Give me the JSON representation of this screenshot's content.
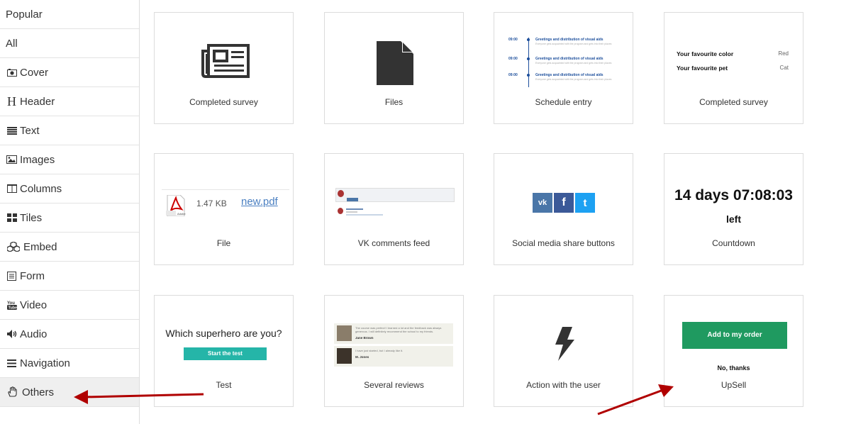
{
  "sidebar": {
    "items": [
      {
        "label": "Popular",
        "icon": ""
      },
      {
        "label": "All",
        "icon": ""
      },
      {
        "label": "Cover",
        "icon": "camera-icon"
      },
      {
        "label": "Header",
        "icon": "header-icon"
      },
      {
        "label": "Text",
        "icon": "text-lines-icon"
      },
      {
        "label": "Images",
        "icon": "image-icon"
      },
      {
        "label": "Columns",
        "icon": "columns-icon"
      },
      {
        "label": "Tiles",
        "icon": "tiles-icon"
      },
      {
        "label": "Embed",
        "icon": "cubes-icon"
      },
      {
        "label": "Form",
        "icon": "form-icon"
      },
      {
        "label": "Video",
        "icon": "youtube-icon"
      },
      {
        "label": "Audio",
        "icon": "speaker-icon"
      },
      {
        "label": "Navigation",
        "icon": "bars-icon"
      },
      {
        "label": "Others",
        "icon": "hand-icon"
      }
    ],
    "header_glyph": "H"
  },
  "cards": {
    "completed_survey_1": "Completed survey",
    "files": "Files",
    "schedule_entry": "Schedule entry",
    "completed_survey_2": "Completed survey",
    "file": "File",
    "vk_comments": "VK comments feed",
    "social_share": "Social media share buttons",
    "countdown": "Countdown",
    "test": "Test",
    "several_reviews": "Several reviews",
    "action_user": "Action with the user",
    "upsell": "UpSell"
  },
  "schedule_preview": {
    "rows": [
      {
        "time": "09:00",
        "title": "Greetings and distribution of visual aids",
        "sub": "Everyone gets acquainted with the program and gets into their places"
      },
      {
        "time": "09:00",
        "title": "Greetings and distribution of visual aids",
        "sub": "Everyone gets acquainted with the program and gets into their places"
      },
      {
        "time": "09:00",
        "title": "Greetings and distribution of visual aids",
        "sub": "Everyone gets acquainted with the program and gets into their places"
      }
    ]
  },
  "survey_preview": {
    "rows": [
      {
        "question": "Your favourite color",
        "answer": "Red"
      },
      {
        "question": "Your favourite pet",
        "answer": "Cat"
      }
    ]
  },
  "file_preview": {
    "size": "1.47 KB",
    "name": "new.pdf",
    "badge": "Adobe"
  },
  "social_preview": {
    "vk": "vk",
    "facebook": "f",
    "twitter": "t"
  },
  "countdown_preview": {
    "value": "14 days 07:08:03",
    "suffix": "left"
  },
  "test_preview": {
    "question": "Which superhero are you?",
    "button": "Start the test"
  },
  "reviews_preview": {
    "items": [
      {
        "text1": "The course was perfect! I learned a lot and the feedback was always",
        "text2": "generous. I will definitely recommend the school to my friends.",
        "name": "Jane Brown"
      },
      {
        "text1": "I have just started, but I already like it.",
        "text2": "",
        "name": "M. Jones"
      }
    ]
  },
  "upsell_preview": {
    "button": "Add to my order",
    "decline": "No, thanks"
  },
  "colors": {
    "accent_green": "#1f9a60",
    "test_button": "#25b5a8",
    "arrow": "#b00000",
    "schedule_blue": "#1d4f9c",
    "vk": "#4a76a8",
    "facebook": "#3b5998",
    "twitter": "#1da1f2"
  }
}
